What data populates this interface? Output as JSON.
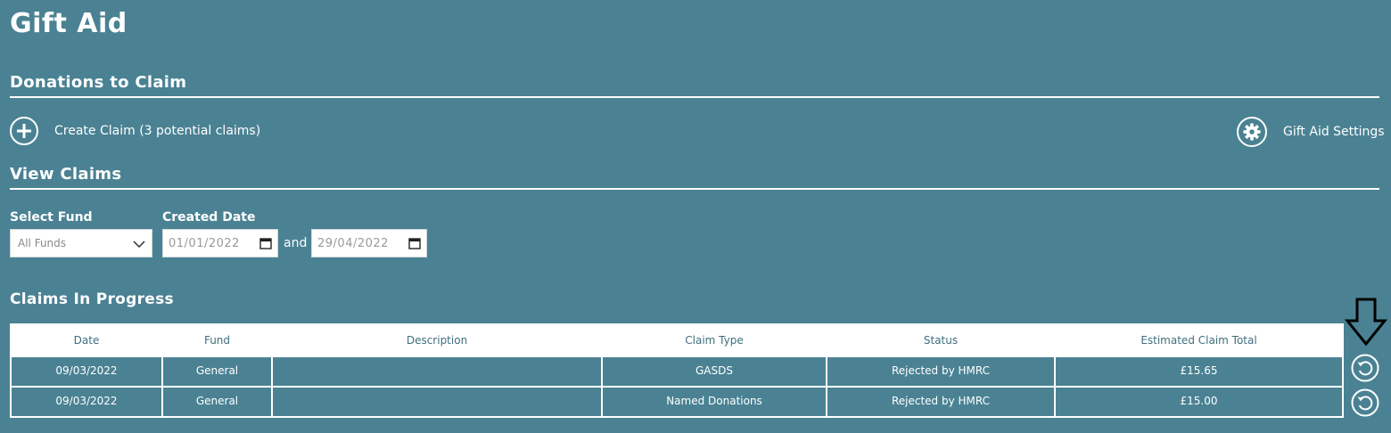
{
  "page": {
    "title": "Gift Aid"
  },
  "donations": {
    "heading": "Donations to Claim",
    "create_claim_label": "Create Claim (3 potential claims)",
    "settings_label": "Gift Aid Settings"
  },
  "view_claims": {
    "heading": "View Claims",
    "fund_label": "Select Fund",
    "fund_value": "All Funds",
    "date_label": "Created Date",
    "date_from": "01/01/2022",
    "and_label": "and",
    "date_to": "29/04/2022"
  },
  "claims_in_progress": {
    "heading": "Claims In Progress",
    "columns": [
      "Date",
      "Fund",
      "Description",
      "Claim Type",
      "Status",
      "Estimated Claim Total"
    ],
    "rows": [
      {
        "date": "09/03/2022",
        "fund": "General",
        "description": "",
        "claim_type": "GASDS",
        "status": "Rejected by HMRC",
        "total": "£15.65"
      },
      {
        "date": "09/03/2022",
        "fund": "General",
        "description": "",
        "claim_type": "Named Donations",
        "status": "Rejected by HMRC",
        "total": "£15.00"
      }
    ]
  },
  "icons": {
    "create": "plus-circle-icon",
    "settings": "gear-icon",
    "row_action": "refresh-icon",
    "marker": "down-arrow-icon"
  },
  "colors": {
    "background": "#4a8293",
    "header_text": "#3e6e7d"
  }
}
